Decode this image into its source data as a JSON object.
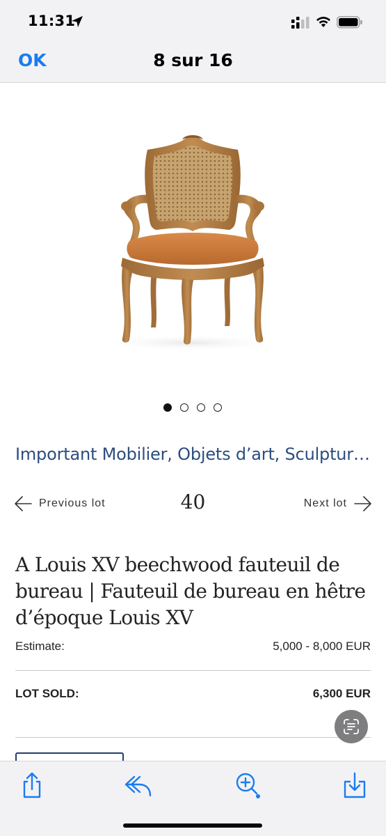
{
  "status_bar": {
    "time": "11:31",
    "icons": [
      "location-arrow-icon",
      "cellular-signal-icon",
      "wifi-icon",
      "battery-icon"
    ]
  },
  "nav": {
    "done_label": "OK",
    "title": "8 sur 16"
  },
  "carousel": {
    "total": 4,
    "active_index": 0
  },
  "sale": {
    "title": "Important Mobilier, Objets d’art, Sculptur…"
  },
  "lot_nav": {
    "previous_label": "Previous lot",
    "lot_number": "40",
    "next_label": "Next lot"
  },
  "lot": {
    "title": "A Louis XV beechwood fauteuil de bureau | Fauteuil de bureau en hêtre d’époque Louis XV",
    "estimate_label": "Estimate:",
    "estimate_value": "5,000 - 8,000 EUR",
    "sold_label": "LOT SOLD:",
    "sold_value": "6,300 EUR"
  },
  "toolbar": {
    "icons": [
      "share-icon",
      "reply-icon",
      "markup-icon",
      "save-icon"
    ]
  },
  "colors": {
    "accent": "#1a7cf0",
    "sale_title": "#2c4d7f",
    "bar_background": "#f2f2f5",
    "chair_wood": "#b8834a",
    "chair_leather": "#c9773a"
  }
}
